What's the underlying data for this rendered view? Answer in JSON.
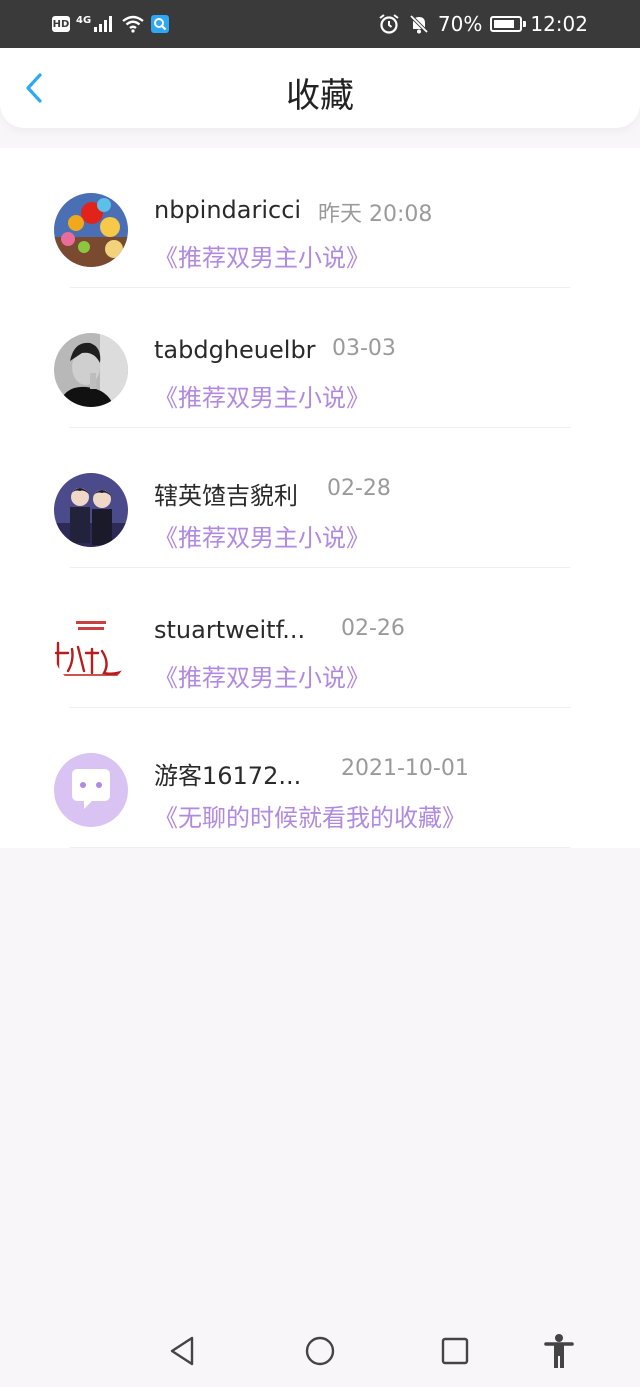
{
  "status_bar": {
    "hd": "HD",
    "network": "4G",
    "battery": "70%",
    "battery_level": 0.7,
    "time": "12:02",
    "icons": [
      "signal-icon",
      "wifi-icon",
      "search-app-icon",
      "alarm-icon",
      "mute-icon",
      "battery-icon"
    ]
  },
  "header": {
    "title": "收藏",
    "back_icon": "chevron-left-icon"
  },
  "favorites": [
    {
      "name": "nbpindaricci",
      "time": "昨天 20:08",
      "book": "《推荐双男主小说》",
      "avatar": "balloons-photo"
    },
    {
      "name": "tabdgheuelbr",
      "time": "03-03",
      "book": "《推荐双男主小说》",
      "avatar": "portrait-photo"
    },
    {
      "name": "辖英馇吉貌利",
      "time": "02-28",
      "book": "《推荐双男主小说》",
      "avatar": "anime-photo"
    },
    {
      "name": "stuartweitf...",
      "time": "02-26",
      "book": "《推荐双男主小说》",
      "avatar": "calligraphy-photo"
    },
    {
      "name": "游客16172...",
      "time": "2021-10-01",
      "book": "《无聊的时候就看我的收藏》",
      "avatar": "chat-bubble-avatar"
    }
  ],
  "nav": {
    "icons": [
      "back-triangle-icon",
      "home-circle-icon",
      "recents-square-icon",
      "accessibility-icon"
    ]
  },
  "colors": {
    "accent": "#2fa8f3",
    "book_title": "#b08ae0",
    "status_bar": "#3a3a3a",
    "page_bg": "#f8f6f8"
  }
}
